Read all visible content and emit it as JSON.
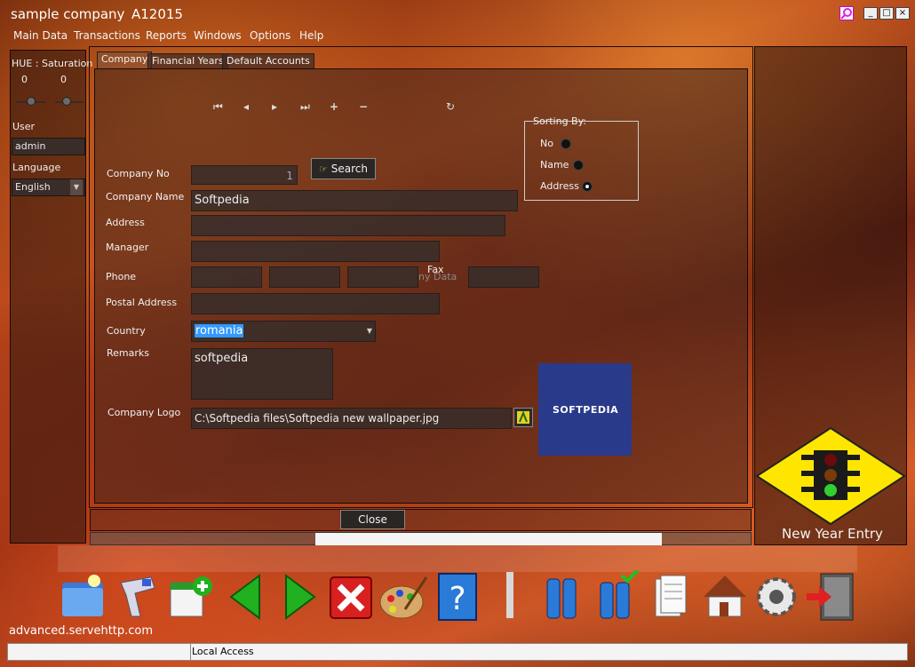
{
  "window": {
    "title": "sample company",
    "code": "A12015",
    "minimize": "_",
    "maximize": "□",
    "close": "×"
  },
  "menu": [
    "Main Data",
    "Transactions",
    "Reports",
    "Windows",
    "Options",
    "Help"
  ],
  "left_panel": {
    "hue_label": "HUE :",
    "saturation_label": "Saturation",
    "hue_value": "0",
    "saturation_value": "0",
    "user_label": "User",
    "user_value": "admin",
    "language_label": "Language",
    "language_value": "English"
  },
  "tabs": [
    "Company",
    "Financial Years",
    "Default Accounts"
  ],
  "form": {
    "company_no_label": "Company No",
    "company_no_value": "1",
    "search_label": "Search",
    "company_name_label": "Company Name",
    "company_name_value": "Softpedia",
    "address_label": "Address",
    "address_value": "",
    "manager_label": "Manager",
    "manager_value": "",
    "phone_label": "Phone",
    "fax_label": "Fax",
    "ghost_text": "ny Data",
    "postal_label": "Postal Address",
    "postal_value": "",
    "country_label": "Country",
    "country_value": "romania",
    "remarks_label": "Remarks",
    "remarks_value": "softpedia",
    "logo_label": "Company Logo",
    "logo_path": "C:\\Softpedia files\\Softpedia new wallpaper.jpg",
    "logo_text": "SOFTPEDIA"
  },
  "sorting": {
    "title": "Sorting By:",
    "options": [
      "No",
      "Name",
      "Address"
    ],
    "selected": "Address"
  },
  "close_label": "Close",
  "right_panel": {
    "new_year_label": "New Year Entry"
  },
  "toolbar_icons": [
    "open-folder-icon",
    "scanner-icon",
    "new-record-icon",
    "previous-icon",
    "next-icon",
    "delete-icon",
    "palette-icon",
    "help-icon",
    "batteries-icon",
    "battery-check-icon",
    "documents-icon",
    "home-icon",
    "settings-icon",
    "exit-icon"
  ],
  "footer": {
    "url": "advanced.servehttp.com",
    "status": "Local Access"
  },
  "colors": {
    "accent_selection": "#3399ff",
    "sign_yellow": "#ffe600",
    "logo_bg": "#2a3a8a"
  }
}
